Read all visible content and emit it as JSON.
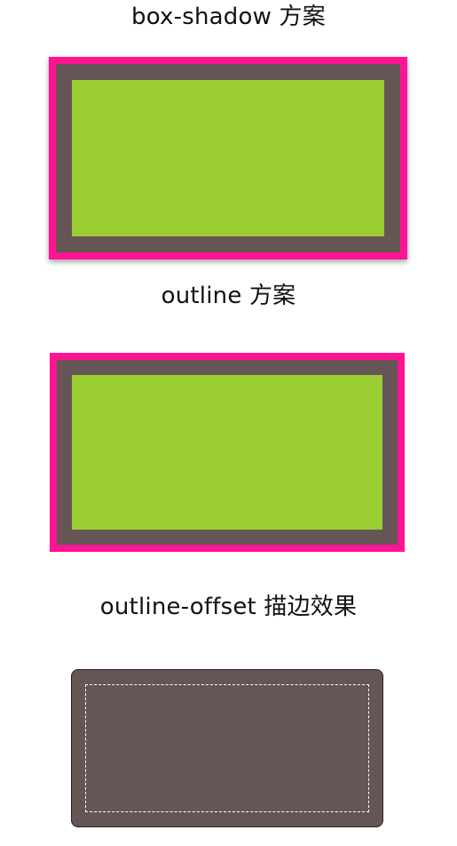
{
  "sections": {
    "box_shadow": {
      "title": "box-shadow 方案"
    },
    "outline": {
      "title": "outline 方案"
    },
    "outline_offset": {
      "title": "outline-offset 描边效果"
    }
  },
  "colors": {
    "pink": "#ff1493",
    "brown": "#665555",
    "green": "#9acd32",
    "dashed": "#ffffff"
  }
}
